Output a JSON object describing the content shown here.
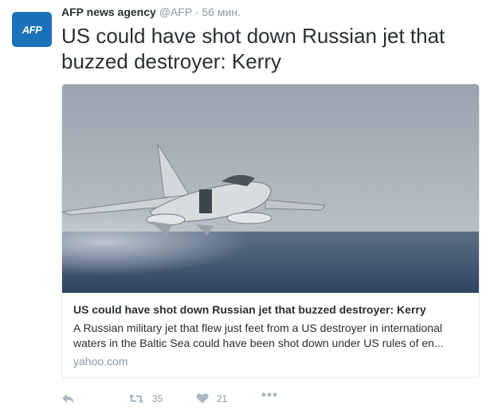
{
  "tweet": {
    "author_name": "AFP news agency",
    "author_handle": "@AFP",
    "separator": "·",
    "time": "56 мин.",
    "avatar_text": "AFP",
    "text": "US could have shot down Russian jet that buzzed destroyer: Kerry"
  },
  "card": {
    "image_icon": "jet-over-sea-photo",
    "title": "US could have shot down Russian jet that buzzed destroyer: Kerry",
    "description": "A Russian military jet that flew just feet from a US destroyer in international waters in the Baltic Sea could have been shot down under US rules of en...",
    "domain": "yahoo.com"
  },
  "actions": {
    "reply_icon": "reply-icon",
    "retweet_icon": "retweet-icon",
    "retweet_count": "35",
    "like_icon": "heart-icon",
    "like_count": "21",
    "more_icon": "more-icon"
  },
  "colors": {
    "avatar_bg": "#1b72b8",
    "muted": "#8899a6",
    "action_icon": "#aab8c2",
    "text": "#292f33",
    "border": "#e1e8ed"
  }
}
